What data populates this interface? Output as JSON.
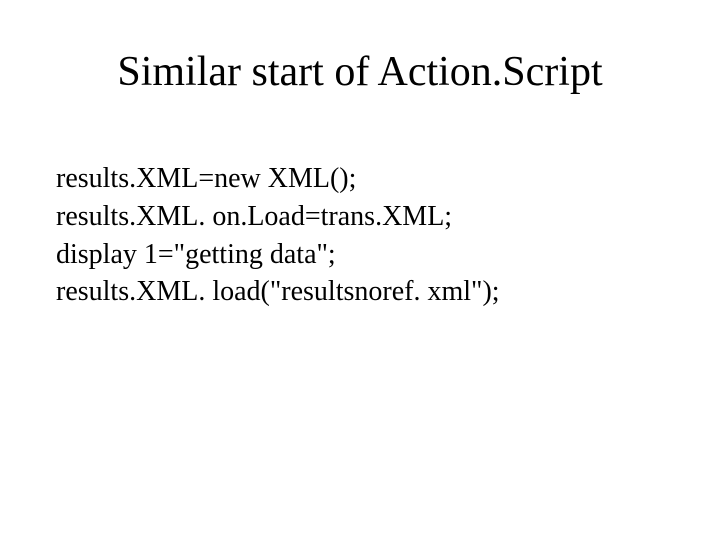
{
  "slide": {
    "title": "Similar start of Action.Script",
    "code": {
      "line1": "results.XML=new XML();",
      "line2": "results.XML. on.Load=trans.XML;",
      "line3": "display 1=\"getting data\";",
      "line4": "results.XML. load(\"resultsnoref. xml\");"
    }
  }
}
